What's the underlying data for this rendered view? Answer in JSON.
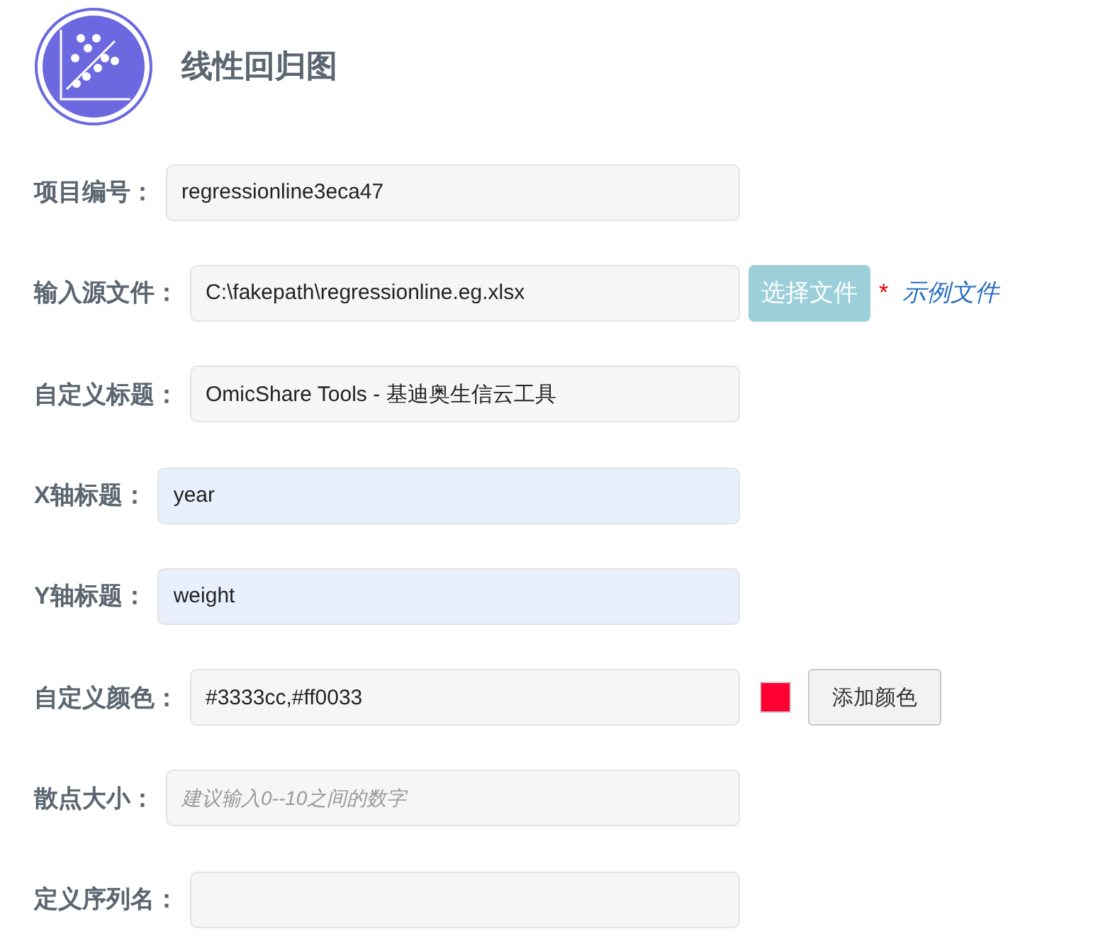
{
  "title": "线性回归图",
  "fields": [
    {
      "kind": "text",
      "label": "项目编号：",
      "value": "regressionline3eca47",
      "autofilled": false
    },
    {
      "kind": "file",
      "label": "输入源文件：",
      "value": "C:\\fakepath\\regressionline.eg.xlsx",
      "autofilled": false,
      "button": "选择文件",
      "required_mark": "*",
      "link": "示例文件"
    },
    {
      "kind": "text",
      "label": "自定义标题：",
      "value": "OmicShare Tools - 基迪奥生信云工具",
      "autofilled": false
    },
    {
      "kind": "text",
      "label": "X轴标题：",
      "value": "year",
      "autofilled": true
    },
    {
      "kind": "text",
      "label": "Y轴标题：",
      "value": "weight",
      "autofilled": true
    },
    {
      "kind": "color",
      "label": "自定义颜色：",
      "value": "#3333cc,#ff0033",
      "autofilled": false,
      "color": "#ff0033",
      "button": "添加颜色"
    },
    {
      "kind": "text",
      "label": "散点大小：",
      "placeholder": "建议输入0--10之间的数字",
      "autofilled": false
    },
    {
      "kind": "text",
      "label": "定义序列名：",
      "autofilled": false
    }
  ]
}
